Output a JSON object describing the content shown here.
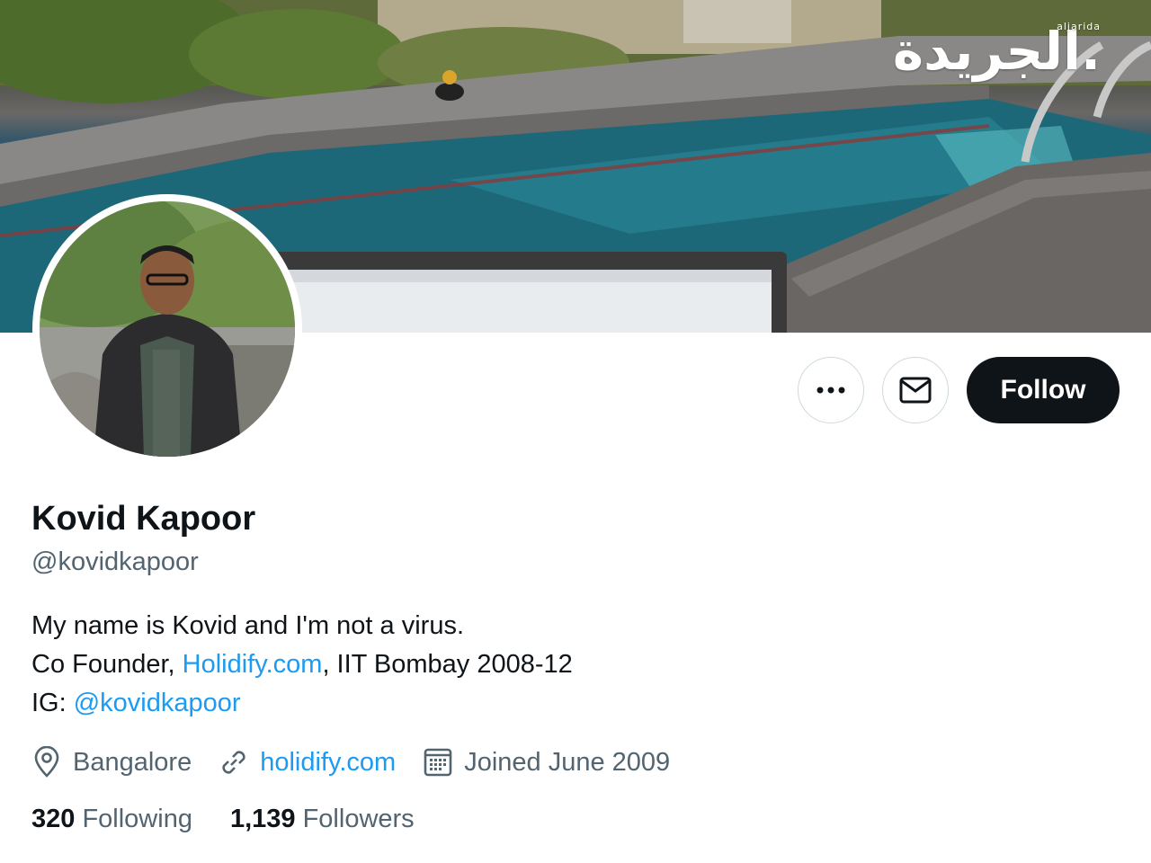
{
  "watermark": {
    "arabic": "الجريدة.",
    "latin": "aljarida"
  },
  "actions": {
    "more_icon": "more-horizontal-icon",
    "message_icon": "envelope-icon",
    "follow_label": "Follow"
  },
  "profile": {
    "name": "Kovid Kapoor",
    "handle": "@kovidkapoor",
    "bio": {
      "line1": "My name is Kovid and I'm not a virus.",
      "line2_prefix": "Co Founder, ",
      "line2_link": "Holidify.com",
      "line2_suffix": ", IIT Bombay 2008-12",
      "line3_prefix": "IG: ",
      "line3_link": "@kovidkapoor"
    },
    "location": "Bangalore",
    "website": "holidify.com",
    "joined": "Joined June 2009"
  },
  "stats": {
    "following_count": "320",
    "following_label": "Following",
    "followers_count": "1,139",
    "followers_label": "Followers"
  },
  "colors": {
    "link": "#1d9bf0",
    "secondary_text": "#536471",
    "primary_text": "#0f1419",
    "follow_bg": "#0f1419"
  }
}
